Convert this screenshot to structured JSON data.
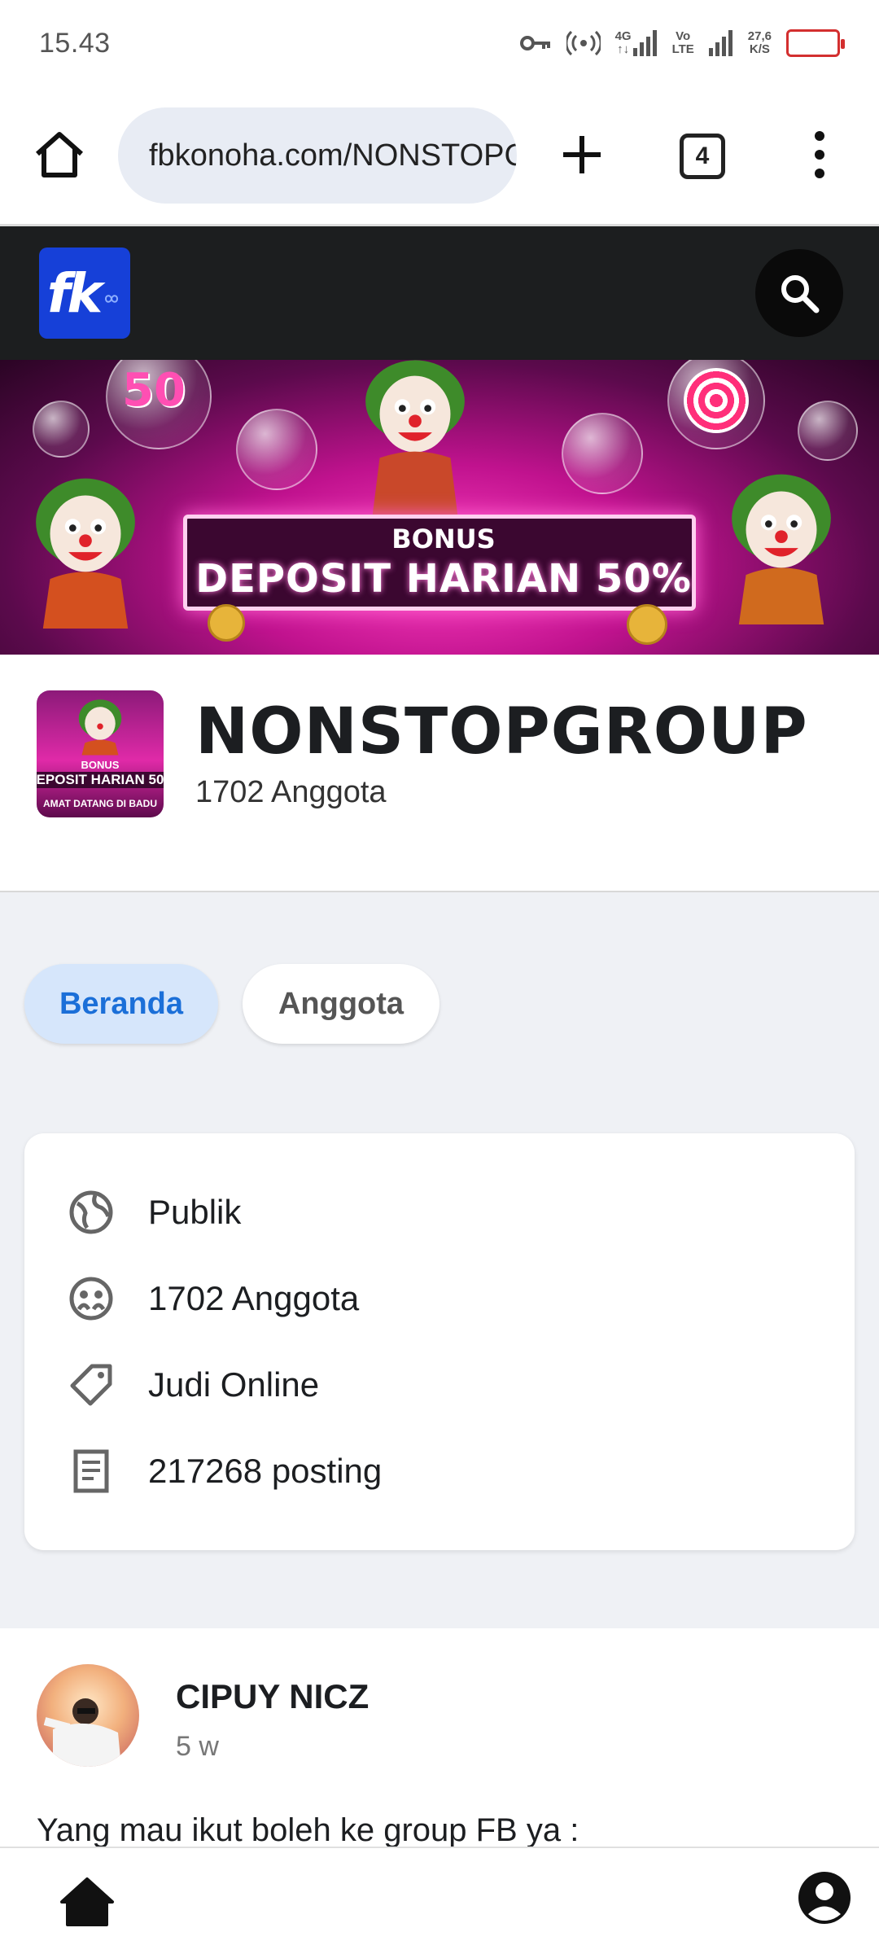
{
  "status_bar": {
    "time": "15.43",
    "network_4g": "4G",
    "volte_top": "Vo",
    "volte_bottom": "LTE",
    "speed_value": "27,6",
    "speed_unit": "K/S",
    "icons": [
      "key-icon",
      "hotspot-icon",
      "signal-4g-icon",
      "volte-icon",
      "signal-icon",
      "battery-icon"
    ],
    "battery_color": "#d32f2f"
  },
  "browser": {
    "url": "fbkonoha.com/NONSTOPGROUP",
    "tab_count": "4",
    "icons": [
      "home-icon",
      "site-settings-icon",
      "new-tab-icon",
      "tabs-icon",
      "more-vert-icon"
    ]
  },
  "site": {
    "logo_text": "fk",
    "header_color": "#1c1e1f",
    "logo_color": "#1640d8"
  },
  "banner": {
    "line1": "BONUS",
    "line2": "DEPOSIT HARIAN 50%",
    "badge": "50"
  },
  "group": {
    "name": "NONSTOPGROUP",
    "members": "1702 Anggota",
    "avatar_line1": "BONUS",
    "avatar_line2": "EPOSIT HARIAN 50",
    "avatar_line3": "AMAT DATANG DI BADU"
  },
  "tabs": [
    {
      "label": "Beranda",
      "active": true
    },
    {
      "label": "Anggota",
      "active": false
    }
  ],
  "accent_color": "#1b6fd8",
  "info": {
    "privacy": "Publik",
    "members": "1702 Anggota",
    "category": "Judi Online",
    "posts": "217268 posting"
  },
  "post": {
    "author": "CIPUY NICZ",
    "time": "5 w",
    "text": "Yang mau ikut boleh ke group FB ya :"
  },
  "bottom_nav": {
    "icons": [
      "home-icon",
      "account-icon"
    ]
  }
}
